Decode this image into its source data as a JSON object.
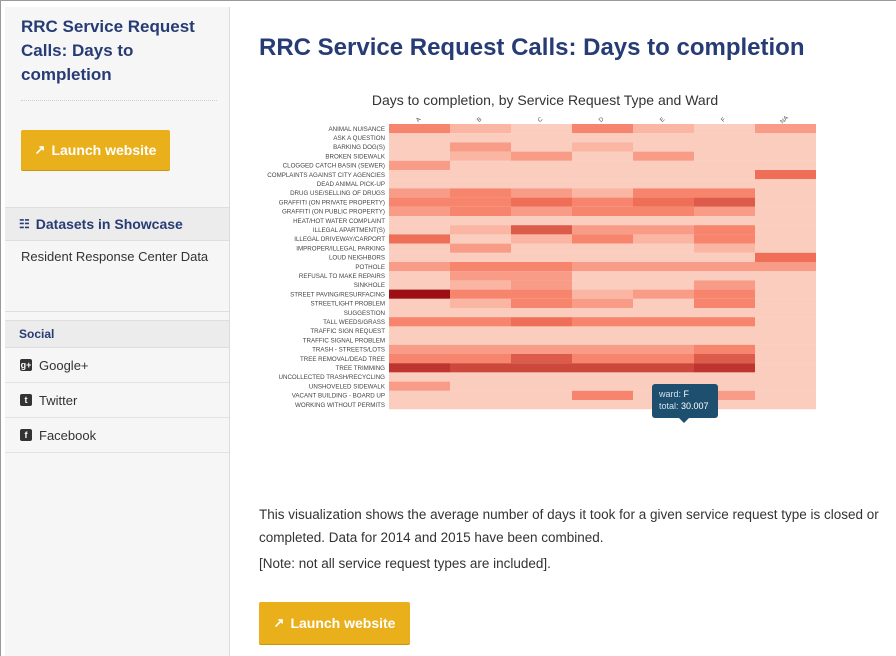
{
  "sidebar": {
    "title": "RRC Service Request Calls: Days to completion",
    "launch_label": "Launch website",
    "datasets_heading": "Datasets in Showcase",
    "dataset_item": "Resident Response Center Data",
    "social_heading": "Social",
    "social": [
      {
        "icon": "google-plus-icon",
        "label": "Google+"
      },
      {
        "icon": "twitter-icon",
        "label": "Twitter"
      },
      {
        "icon": "facebook-icon",
        "label": "Facebook"
      }
    ]
  },
  "main": {
    "title": "RRC Service Request Calls: Days to completion",
    "description": "This visualization shows the average number of days it took for a given service request type is closed or completed. Data for 2014 and 2015 have been combined.",
    "note": "[Note: not all service request types are included].",
    "launch_label": "Launch website"
  },
  "tooltip": {
    "ward_label": "ward:",
    "ward_value": "F",
    "total_label": "total:",
    "total_value": "30.007"
  },
  "colors": {
    "accent": "#e9b01c",
    "brand": "#273c75",
    "heat_low": "#fde5d9",
    "heat_high": "#9c0f12"
  },
  "chart_data": {
    "type": "heatmap",
    "title": "Days to completion, by Service Request Type and Ward",
    "x": [
      "A",
      "B",
      "C",
      "D",
      "E",
      "F",
      "NA"
    ],
    "y": [
      "ANIMAL NUISANCE",
      "ASK A QUESTION",
      "BARKING DOG(S)",
      "BROKEN SIDEWALK",
      "CLOGGED CATCH BASIN (SEWER)",
      "COMPLAINTS AGAINST CITY AGENCIES",
      "DEAD ANIMAL PICK-UP",
      "DRUG USE/SELLING OF DRUGS",
      "GRAFFITI (ON PRIVATE PROPERTY)",
      "GRAFFITI (ON PUBLIC PROPERTY)",
      "HEAT/HOT WATER COMPLAINT",
      "ILLEGAL APARTMENT(S)",
      "ILLEGAL DRIVEWAY/CARPORT",
      "IMPROPER/ILLEGAL PARKING",
      "LOUD NEIGHBORS",
      "POTHOLE",
      "REFUSAL TO MAKE REPAIRS",
      "SINKHOLE",
      "STREET PAVING/RESURFACING",
      "STREETLIGHT PROBLEM",
      "SUGGESTION",
      "TALL WEEDS/GRASS",
      "TRAFFIC SIGN REQUEST",
      "TRAFFIC SIGNAL PROBLEM",
      "TRASH - STREETS/LOTS",
      "TREE REMOVAL/DEAD TREE",
      "TREE TRIMMING",
      "UNCOLLECTED TRASH/RECYCLING",
      "UNSHOVELED SIDEWALK",
      "VACANT BUILDING - BOARD UP",
      "WORKING WITHOUT PERMITS"
    ],
    "values": [
      [
        4,
        2,
        1,
        4,
        2,
        1,
        3
      ],
      [
        1,
        1,
        1,
        1,
        1,
        1,
        1
      ],
      [
        1,
        3,
        1,
        2,
        1,
        1,
        1
      ],
      [
        1,
        2,
        3,
        1,
        3,
        1,
        1
      ],
      [
        3,
        1,
        1,
        1,
        1,
        1,
        1
      ],
      [
        1,
        1,
        1,
        1,
        1,
        1,
        5
      ],
      [
        1,
        1,
        1,
        1,
        1,
        1,
        1
      ],
      [
        3,
        4,
        3,
        2,
        4,
        4,
        1
      ],
      [
        4,
        4,
        5,
        4,
        5,
        6,
        1
      ],
      [
        3,
        4,
        3,
        4,
        4,
        3,
        1
      ],
      [
        1,
        1,
        1,
        1,
        1,
        1,
        1
      ],
      [
        1,
        2,
        6,
        3,
        3,
        4,
        1
      ],
      [
        5,
        1,
        2,
        4,
        2,
        4,
        1
      ],
      [
        1,
        3,
        1,
        1,
        1,
        2,
        1
      ],
      [
        1,
        1,
        1,
        1,
        1,
        1,
        5
      ],
      [
        3,
        4,
        4,
        3,
        3,
        3,
        3
      ],
      [
        1,
        3,
        3,
        1,
        1,
        1,
        1
      ],
      [
        1,
        2,
        3,
        1,
        1,
        3,
        1
      ],
      [
        10,
        4,
        4,
        2,
        3,
        4,
        1
      ],
      [
        1,
        2,
        4,
        3,
        1,
        4,
        1
      ],
      [
        1,
        1,
        1,
        1,
        1,
        1,
        1
      ],
      [
        4,
        4,
        5,
        4,
        4,
        4,
        1
      ],
      [
        1,
        1,
        1,
        1,
        1,
        1,
        1
      ],
      [
        1,
        1,
        1,
        1,
        1,
        1,
        1
      ],
      [
        3,
        3,
        3,
        3,
        3,
        4,
        1
      ],
      [
        4,
        4,
        6,
        4,
        4,
        6,
        1
      ],
      [
        8,
        7,
        7,
        7,
        7,
        8,
        1
      ],
      [
        1,
        1,
        1,
        1,
        1,
        1,
        1
      ],
      [
        3,
        1,
        1,
        1,
        1,
        1,
        1
      ],
      [
        1,
        1,
        1,
        4,
        1,
        3,
        1
      ],
      [
        1,
        1,
        1,
        1,
        1,
        1,
        1
      ]
    ],
    "legend": "none"
  }
}
